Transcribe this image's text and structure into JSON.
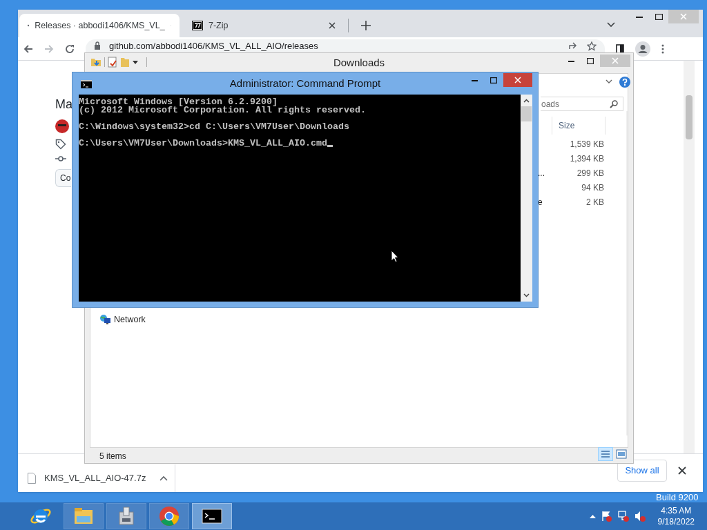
{
  "desktop": {
    "build_label": "Build 9200"
  },
  "browser": {
    "tabs": [
      {
        "title": "Releases · abbodi1406/KMS_VL_",
        "selected": true
      },
      {
        "title": "7-Zip",
        "selected": false
      }
    ],
    "address": "github.com/abbodi1406/KMS_VL_ALL_AIO/releases",
    "page": {
      "heading": "Ma",
      "button": "Co"
    },
    "download_shelf": {
      "file": "KMS_VL_ALL_AIO-47.7z",
      "show_all": "Show all"
    }
  },
  "explorer": {
    "title": "Downloads",
    "search_placeholder": "oads",
    "columns": [
      "Size"
    ],
    "rows": [
      {
        "size": "1,539 KB"
      },
      {
        "size": "1,394 KB"
      },
      {
        "name_fragment": "...",
        "size": "299 KB"
      },
      {
        "size": "94 KB"
      },
      {
        "name_fragment": "e",
        "size": "2 KB"
      }
    ],
    "nav": [
      "Network"
    ],
    "status": "5 items"
  },
  "cmd": {
    "title": "Administrator: Command Prompt",
    "lines": [
      {
        "text": "Microsoft Windows [Version 6.2.9200]",
        "blank_before": false
      },
      {
        "text": "(c) 2012 Microsoft Corporation. All rights reserved.",
        "blank_before": false
      },
      {
        "text": "C:\\Windows\\system32>cd C:\\Users\\VM7User\\Downloads",
        "blank_before": true
      },
      {
        "text": "C:\\Users\\VM7User\\Downloads>KMS_VL_ALL_AIO.cmd",
        "blank_before": true
      }
    ]
  },
  "taskbar": {
    "apps": [
      {
        "kind": "ie",
        "selected": false
      },
      {
        "kind": "explorer",
        "selected": false
      },
      {
        "kind": "setup",
        "selected": false
      },
      {
        "kind": "chrome",
        "selected": false
      },
      {
        "kind": "cmd",
        "selected": true
      }
    ],
    "time": "4:35 AM",
    "date": "9/18/2022"
  }
}
